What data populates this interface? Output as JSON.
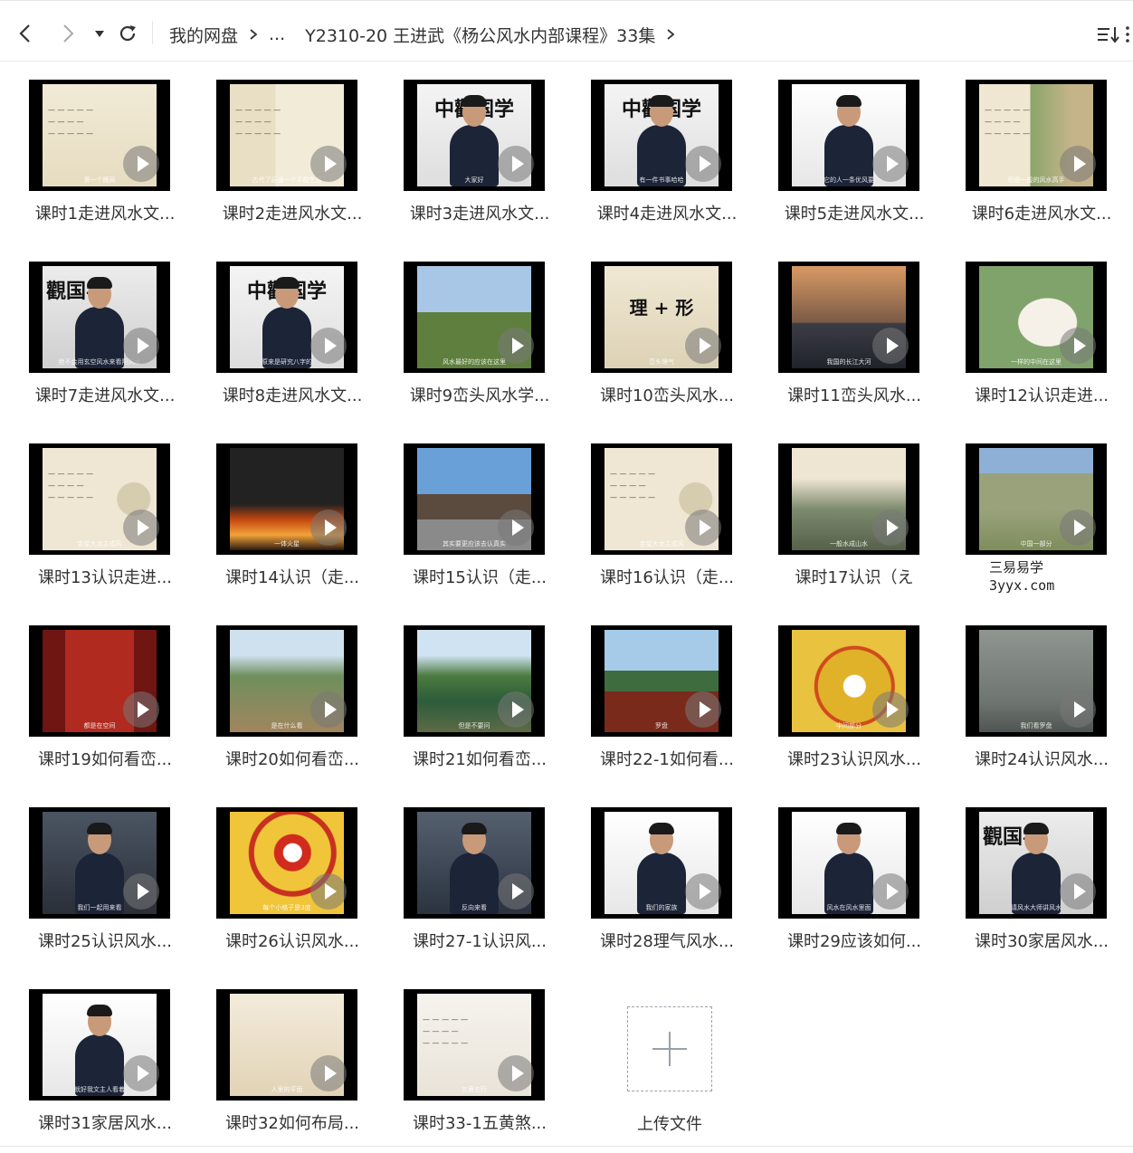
{
  "toolbar": {
    "back_icon": "chevron-left-icon",
    "forward_icon": "chevron-right-icon",
    "history_icon": "caret-down-icon",
    "refresh_icon": "refresh-icon",
    "sort_icon": "sort-icon",
    "more_icon": "more-icon"
  },
  "breadcrumb": {
    "root": "我的网盘",
    "ellipsis": "...",
    "current": "Y2310-20 王进武《杨公风水内部课程》33集"
  },
  "files": [
    {
      "name": "课时1走进风水文...",
      "thumb": "paper",
      "caption": "第一个概局"
    },
    {
      "name": "课时2走进风水文...",
      "thumb": "paper-coins",
      "caption": "古代了玩通一个平稳生活"
    },
    {
      "name": "课时3走进风水文...",
      "thumb": "teacher-calli",
      "caption": "大家好"
    },
    {
      "name": "课时4走进风水文...",
      "thumb": "teacher-calli",
      "caption": "有一件书事哈哈"
    },
    {
      "name": "课时5走进风水文...",
      "thumb": "teacher-white",
      "caption": "它的人一条优风要"
    },
    {
      "name": "课时6走进风水文...",
      "thumb": "paper-photo",
      "caption": "但是一般的风水高手"
    },
    {
      "name": "课时7走进风水文...",
      "thumb": "teacher-close",
      "caption": "绝不会用玄空风水来看阳风水"
    },
    {
      "name": "课时8走进风水文...",
      "thumb": "teacher-calli",
      "caption": "原来是研究八字的"
    },
    {
      "name": "课时9峦头风水学...",
      "thumb": "building",
      "caption": "风水最好的应该在这里"
    },
    {
      "name": "课时10峦头风水...",
      "thumb": "paper-calli",
      "caption": "峦头理气"
    },
    {
      "name": "课时11峦头风水...",
      "thumb": "river",
      "caption": "我国的长江大河"
    },
    {
      "name": "课时12认识走进...",
      "thumb": "map",
      "caption": "一样的中间在这里"
    },
    {
      "name": "课时13认识走进...",
      "thumb": "paper-compass",
      "caption": "金星大龙主成风"
    },
    {
      "name": "课时14认识（走...",
      "thumb": "fire",
      "caption": "一体火星"
    },
    {
      "name": "课时15认识（走...",
      "thumb": "hill",
      "caption": "其实要更应该去认真实"
    },
    {
      "name": "课时16认识（走...",
      "thumb": "paper-compass",
      "caption": "金星大龙主成风"
    },
    {
      "name": "课时17认识（え",
      "thumb": "mountain-line",
      "caption": "一般水成山水"
    },
    {
      "name": "",
      "thumb": "aerial",
      "caption": "中国一部分"
    },
    {
      "name": "课时19如何看峦...",
      "thumb": "temple",
      "caption": "都是在空间"
    },
    {
      "name": "课时20如何看峦...",
      "thumb": "mountain",
      "caption": "是在什么看"
    },
    {
      "name": "课时21如何看峦...",
      "thumb": "landscape-tree",
      "caption": "但是不要问"
    },
    {
      "name": "课时22-1如何看...",
      "thumb": "compass-hand",
      "caption": "罗盘"
    },
    {
      "name": "课时23认识风水...",
      "thumb": "luopan",
      "caption": "中间部分"
    },
    {
      "name": "课时24认识风水...",
      "thumb": "fog",
      "caption": "我们看罗盘"
    },
    {
      "name": "课时25认识风水...",
      "thumb": "teacher-paper",
      "caption": "我们一起用来看"
    },
    {
      "name": "课时26认识风水...",
      "thumb": "luopan-red",
      "caption": "每个小格子是3度"
    },
    {
      "name": "课时27-1认识风...",
      "thumb": "teacher-dark",
      "caption": "反向来看"
    },
    {
      "name": "课时28理气风水...",
      "thumb": "teacher-white",
      "caption": "我们的家族"
    },
    {
      "name": "课时29应该如何...",
      "thumb": "teacher-white",
      "caption": "风水在风水里面"
    },
    {
      "name": "课时30家居风水...",
      "thumb": "teacher-close",
      "caption": "请风水大师讲风水"
    },
    {
      "name": "课时31家居风水...",
      "thumb": "teacher-white",
      "caption": "就好我文主人看着"
    },
    {
      "name": "课时32如何布局...",
      "thumb": "floorplan",
      "caption": "人里的平面"
    },
    {
      "name": "课时33-1五黄煞...",
      "thumb": "text-page",
      "caption": "五黄五行"
    }
  ],
  "watermark": {
    "line1": "三易易学",
    "line2": "3yyx.com"
  },
  "upload": {
    "label": "上传文件",
    "icon": "plus-icon"
  }
}
